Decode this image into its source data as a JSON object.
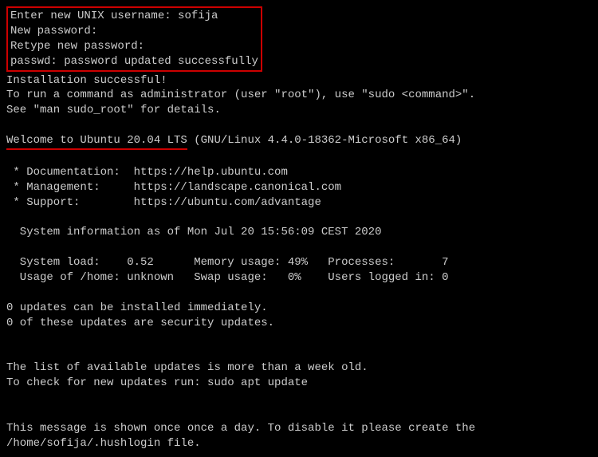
{
  "setup": {
    "prompt_username": "Enter new UNIX username: ",
    "username": "sofija",
    "new_password": "New password:",
    "retype_password": "Retype new password:",
    "passwd_result": "passwd: password updated successfully"
  },
  "install": {
    "success": "Installation successful!",
    "sudo_hint": "To run a command as administrator (user \"root\"), use \"sudo <command>\".",
    "sudo_man": "See \"man sudo_root\" for details."
  },
  "welcome": {
    "title": "Welcome to Ubuntu 20.04 LTS",
    "kernel": " (GNU/Linux 4.4.0-18362-Microsoft x86_64)"
  },
  "links": {
    "doc": " * Documentation:  https://help.ubuntu.com",
    "mgmt": " * Management:     https://landscape.canonical.com",
    "support": " * Support:        https://ubuntu.com/advantage"
  },
  "sysinfo": {
    "header": "  System information as of Mon Jul 20 15:56:09 CEST 2020",
    "row1": "  System load:    0.52      Memory usage: 49%   Processes:       7",
    "row2": "  Usage of /home: unknown   Swap usage:   0%    Users logged in: 0"
  },
  "updates": {
    "line1": "0 updates can be installed immediately.",
    "line2": "0 of these updates are security updates.",
    "stale1": "The list of available updates is more than a week old.",
    "stale2": "To check for new updates run: sudo apt update"
  },
  "motd": {
    "line1": "This message is shown once once a day. To disable it please create the",
    "line2": "/home/sofija/.hushlogin file."
  }
}
